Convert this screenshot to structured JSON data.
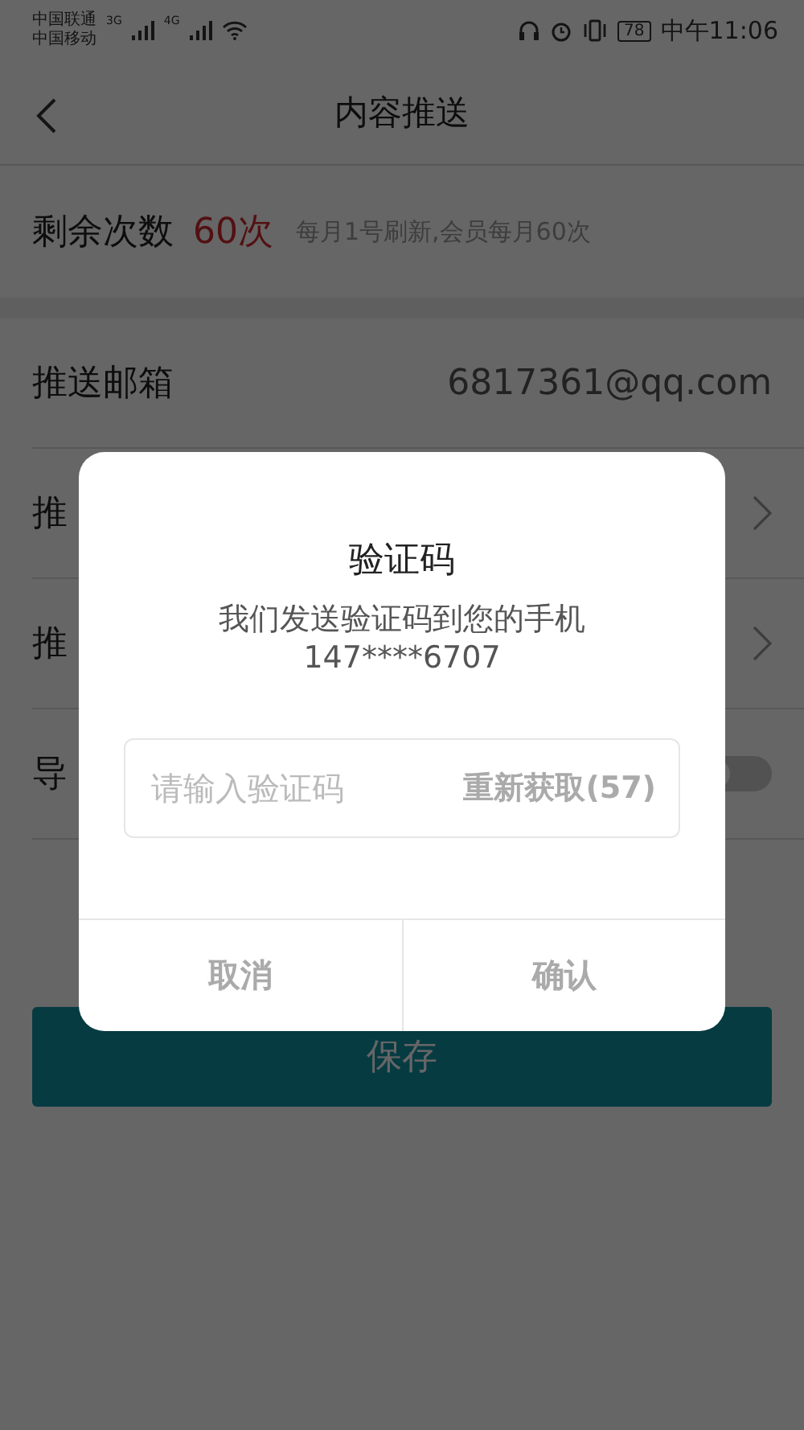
{
  "status_bar": {
    "carriers": [
      "中国联通",
      "中国移动"
    ],
    "network_labels": [
      "3G",
      "4G"
    ],
    "battery": "78",
    "time": "中午11:06"
  },
  "header": {
    "title": "内容推送"
  },
  "quota": {
    "label": "剩余次数",
    "count": "60次",
    "note": "每月1号刷新,会员每月60次"
  },
  "settings": [
    {
      "kind": "value",
      "label": "推送邮箱",
      "value": "6817361@qq.com"
    },
    {
      "kind": "link",
      "label": "推"
    },
    {
      "kind": "link",
      "label": "推"
    },
    {
      "kind": "toggle",
      "label": "导",
      "on": false
    }
  ],
  "save_button": "保存",
  "dialog": {
    "title": "验证码",
    "message": "我们发送验证码到您的手机",
    "phone": "147****6707",
    "input": {
      "placeholder": "请输入验证码"
    },
    "resend": "重新获取(57)",
    "buttons": [
      "取消",
      "确认"
    ]
  }
}
